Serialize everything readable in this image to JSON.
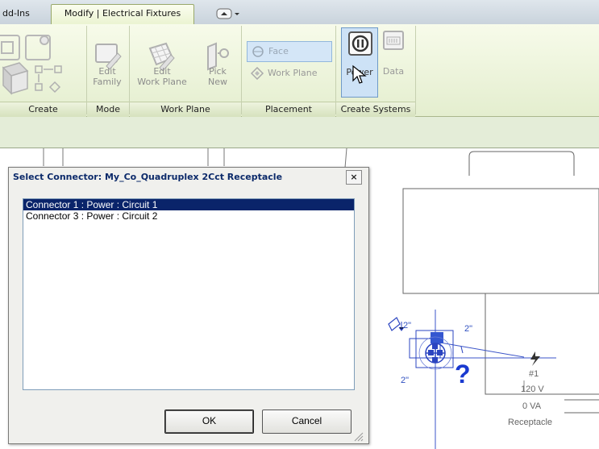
{
  "tabs": {
    "addins": "dd-Ins",
    "modify": "Modify | Electrical Fixtures"
  },
  "ribbon": {
    "panels": {
      "create": "Create",
      "mode": "Mode",
      "work_plane": "Work Plane",
      "placement": "Placement",
      "create_systems": "Create Systems"
    },
    "buttons": {
      "edit_family": [
        "Edit",
        "Family"
      ],
      "edit_work_plane": [
        "Edit",
        "Work Plane"
      ],
      "pick_new": [
        "Pick",
        "New"
      ],
      "face": "Face",
      "work_plane": "Work Plane",
      "power": "Power",
      "data": "Data"
    }
  },
  "dialog": {
    "title": "Select Connector: My_Co_Quadruplex 2Cct Receptacle",
    "close": "×",
    "connectors": [
      "Connector 1 : Power : Circuit 1",
      "Connector 3 : Power : Circuit 2"
    ],
    "selected_index": 0,
    "ok": "OK",
    "cancel": "Cancel"
  },
  "drawing": {
    "dim_left_top": "2\"",
    "dim_right_top": "2\"",
    "dim_left_bottom": "2\"",
    "question_mark": "?",
    "tag_circuit": "#1",
    "tag_voltage": "120 V",
    "tag_load": "0 VA",
    "tag_type": "Receptacle"
  },
  "colors": {
    "selection": "#0a246a",
    "ribbon": "#e4eecf",
    "annotation_blue": "#1a3ad0"
  }
}
